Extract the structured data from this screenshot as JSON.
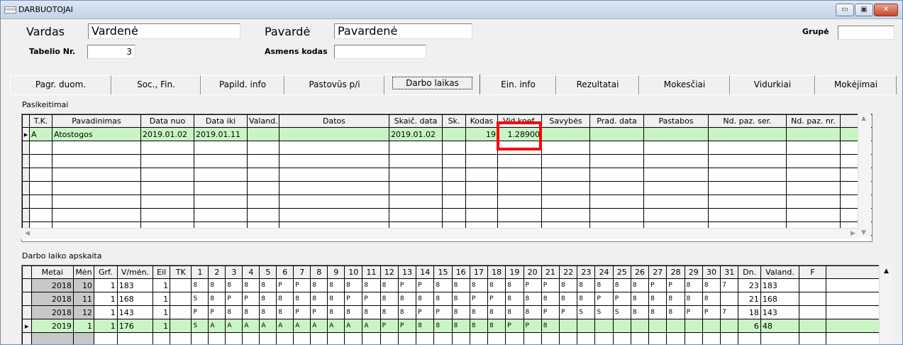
{
  "window": {
    "title": "DARBUOTOJAI",
    "app_icon": "nono",
    "min_symbol": "▭",
    "max_symbol": "▣",
    "close_symbol": "✕"
  },
  "header": {
    "vardas_label": "Vardas",
    "vardas_value": "Vardenė",
    "pavarde_label": "Pavardė",
    "pavarde_value": "Pavardenė",
    "grupe_label": "Grupė",
    "grupe_value": "",
    "tabelio_label": "Tabelio Nr.",
    "tabelio_value": "3",
    "asmens_label": "Asmens kodas",
    "asmens_value": ""
  },
  "tabs": [
    "Pagr. duom.",
    "Soc., Fin.",
    "Papild. info",
    "Pastovūs p/i",
    "Darbo laikas",
    "Ein. info",
    "Rezultatai",
    "Mokesčiai",
    "Vidurkiai",
    "Mokėjimai"
  ],
  "active_tab": 4,
  "pasikeitimai": {
    "title": "Pasikeitimai",
    "columns": [
      "T.K.",
      "Pavadinimas",
      "Data nuo",
      "Data iki",
      "Valand.",
      "Datos",
      "Skaič. data",
      "Sk.",
      "Kodas",
      "Vid.koef.",
      "Savybės",
      "Prad. data",
      "Pastabos",
      "Nd. paz. ser.",
      "Nd. paz. nr."
    ],
    "rows": [
      [
        "A",
        "Atostogos",
        "2019.01.02",
        "2019.01.11",
        "",
        "",
        "2019.01.02",
        "",
        "19",
        "1.28900",
        "",
        "",
        "",
        "",
        ""
      ]
    ],
    "empty_rows": 7
  },
  "darbo": {
    "title": "Darbo laiko apskaita",
    "columns": [
      "Metai",
      "Mėn",
      "Grf.",
      "V/mėn.",
      "Eil",
      "TK",
      "1",
      "2",
      "3",
      "4",
      "5",
      "6",
      "7",
      "8",
      "9",
      "10",
      "11",
      "12",
      "13",
      "14",
      "15",
      "16",
      "17",
      "18",
      "19",
      "20",
      "21",
      "22",
      "23",
      "24",
      "25",
      "26",
      "27",
      "28",
      "29",
      "30",
      "31",
      "Dn.",
      "Valand.",
      "F",
      ""
    ],
    "rows": [
      [
        "2018",
        "10",
        "1",
        "183",
        "1",
        "",
        "8",
        "8",
        "8",
        "8",
        "8",
        "P",
        "P",
        "8",
        "8",
        "8",
        "8",
        "8",
        "P",
        "P",
        "8",
        "8",
        "8",
        "8",
        "8",
        "P",
        "P",
        "8",
        "8",
        "8",
        "8",
        "8",
        "P",
        "P",
        "8",
        "8",
        "7",
        "23",
        "183",
        "",
        ""
      ],
      [
        "2018",
        "11",
        "1",
        "168",
        "1",
        "",
        "S",
        "8",
        "P",
        "P",
        "8",
        "8",
        "8",
        "8",
        "8",
        "P",
        "P",
        "8",
        "8",
        "8",
        "8",
        "8",
        "P",
        "P",
        "8",
        "8",
        "8",
        "8",
        "8",
        "P",
        "P",
        "8",
        "8",
        "8",
        "8",
        "8",
        "",
        "21",
        "168",
        "",
        ""
      ],
      [
        "2018",
        "12",
        "1",
        "143",
        "1",
        "",
        "P",
        "P",
        "8",
        "8",
        "8",
        "8",
        "P",
        "P",
        "8",
        "8",
        "8",
        "8",
        "8",
        "P",
        "P",
        "8",
        "8",
        "8",
        "8",
        "8",
        "P",
        "P",
        "S",
        "S",
        "S",
        "8",
        "8",
        "8",
        "P",
        "P",
        "7",
        "18",
        "143",
        "",
        ""
      ],
      [
        "2019",
        "1",
        "1",
        "176",
        "1",
        "",
        "S",
        "A",
        "A",
        "A",
        "A",
        "A",
        "A",
        "A",
        "A",
        "A",
        "A",
        "P",
        "P",
        "8",
        "8",
        "8",
        "8",
        "8",
        "P",
        "P",
        "8",
        "",
        "",
        "",
        "",
        "",
        "",
        "",
        "",
        "",
        "",
        "6",
        "48",
        "",
        ""
      ]
    ],
    "empty_rows": 1
  }
}
